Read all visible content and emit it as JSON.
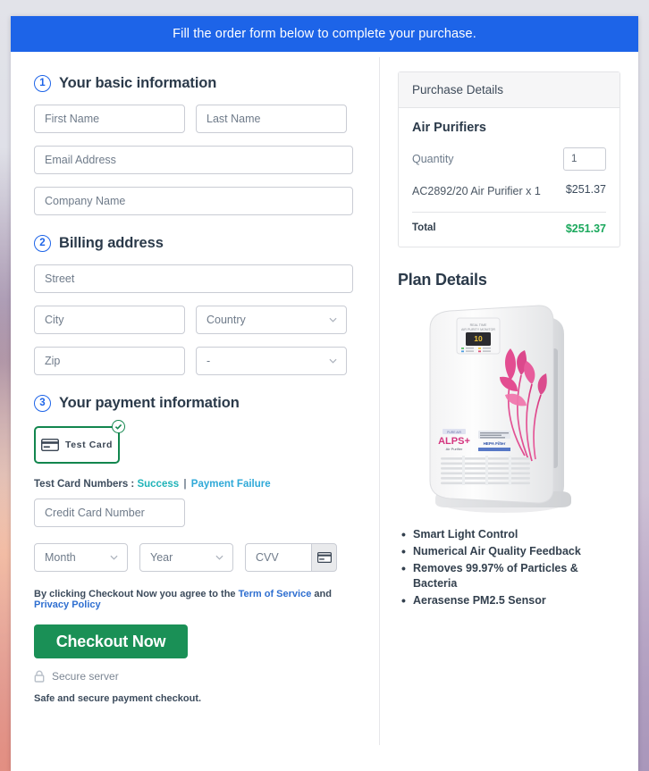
{
  "banner": {
    "text": "Fill the order form below to complete your purchase."
  },
  "theme": {
    "banner_blue": "#1d64e8",
    "step_blue": "#1d64e8",
    "checkout_green": "#1a9056",
    "total_green": "#1aa85c",
    "testcard_green": "#12864e",
    "link_blue": "#2f6fd0",
    "link_success": "#1fb3b8",
    "link_failure": "#2fa9d8"
  },
  "basic_info": {
    "step_number": "1",
    "title": "Your basic information",
    "first_name_placeholder": "First Name",
    "last_name_placeholder": "Last Name",
    "email_placeholder": "Email Address",
    "company_placeholder": "Company Name"
  },
  "billing": {
    "step_number": "2",
    "title": "Billing address",
    "street_placeholder": "Street",
    "city_placeholder": "City",
    "country_placeholder": "Country",
    "zip_placeholder": "Zip",
    "state_placeholder": "-",
    "chevron_icon": "chevron-down-icon"
  },
  "payment": {
    "step_number": "3",
    "title": "Your payment information",
    "test_card_label": "Test Card",
    "card_icon": "credit-card-icon",
    "selected_badge_icon": "check-circle-icon",
    "test_numbers_label": "Test Card Numbers :",
    "success_link": "Success",
    "separator": "|",
    "failure_link": "Payment Failure",
    "card_number_placeholder": "Credit Card Number",
    "month_placeholder": "Month",
    "year_placeholder": "Year",
    "cvv_placeholder": "CVV",
    "cvv_icon": "credit-card-icon",
    "terms_prefix": "By clicking Checkout Now you agree to the",
    "terms_link": "Term of Service",
    "terms_and": "and",
    "privacy_link": "Privacy Policy",
    "checkout_label": "Checkout Now",
    "secure_icon": "lock-icon",
    "secure_label": "Secure server",
    "safe_note": "Safe and secure payment checkout."
  },
  "purchase_details": {
    "header": "Purchase Details",
    "product_group": "Air Purifiers",
    "quantity_label": "Quantity",
    "quantity_value": "1",
    "line_items": [
      {
        "description": "AC2892/20 Air Purifier x 1",
        "amount": "$251.37"
      }
    ],
    "total_label": "Total",
    "total_amount": "$251.37"
  },
  "plan_details": {
    "title": "Plan Details",
    "product_image_name": "air-purifier-product-image",
    "product_display_text": {
      "monitor_line1": "REAL TIME",
      "monitor_line2": "AIR PURITY MONITOR",
      "reading": "10",
      "brand": "ALPS+",
      "brand_sub": "Air Purifier",
      "filter_badge": "HEPA Filter"
    },
    "features": [
      "Smart Light Control",
      "Numerical Air Quality Feedback",
      "Removes 99.97% of Particles & Bacteria",
      "Aerasense PM2.5 Sensor"
    ]
  }
}
